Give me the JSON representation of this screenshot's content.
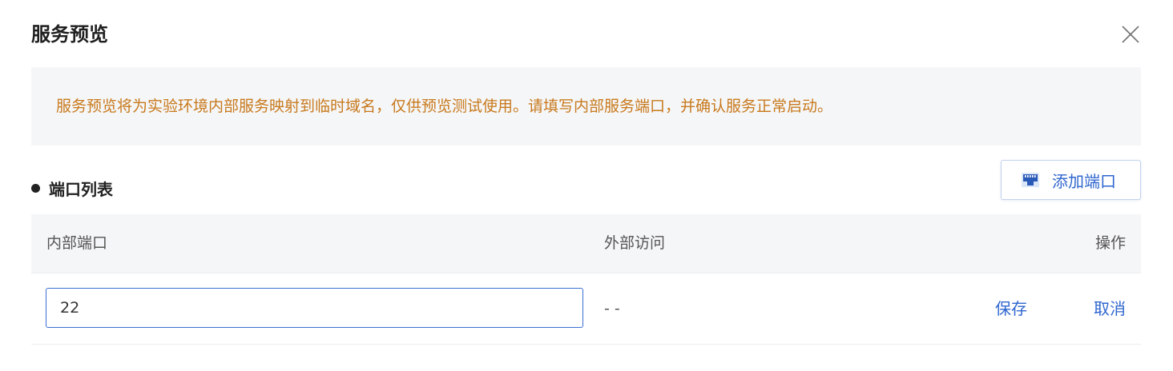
{
  "dialog": {
    "title": "服务预览",
    "close_icon": "close-icon"
  },
  "notice": {
    "text": "服务预览将为实验环境内部服务映射到临时域名，仅供预览测试使用。请填写内部服务端口，并确认服务正常启动。",
    "color": "#c8791c"
  },
  "section": {
    "title": "端口列表",
    "add_button_label": "添加端口",
    "add_button_icon": "network-port-icon"
  },
  "table": {
    "headers": {
      "internal_port": "内部端口",
      "external_access": "外部访问",
      "actions": "操作"
    },
    "rows": [
      {
        "internal_port_value": "22",
        "external_access": "- -",
        "save_label": "保存",
        "cancel_label": "取消"
      }
    ]
  },
  "colors": {
    "accent": "#2f66cf",
    "warning_text": "#c8791c",
    "panel_bg": "#f5f6f8"
  }
}
